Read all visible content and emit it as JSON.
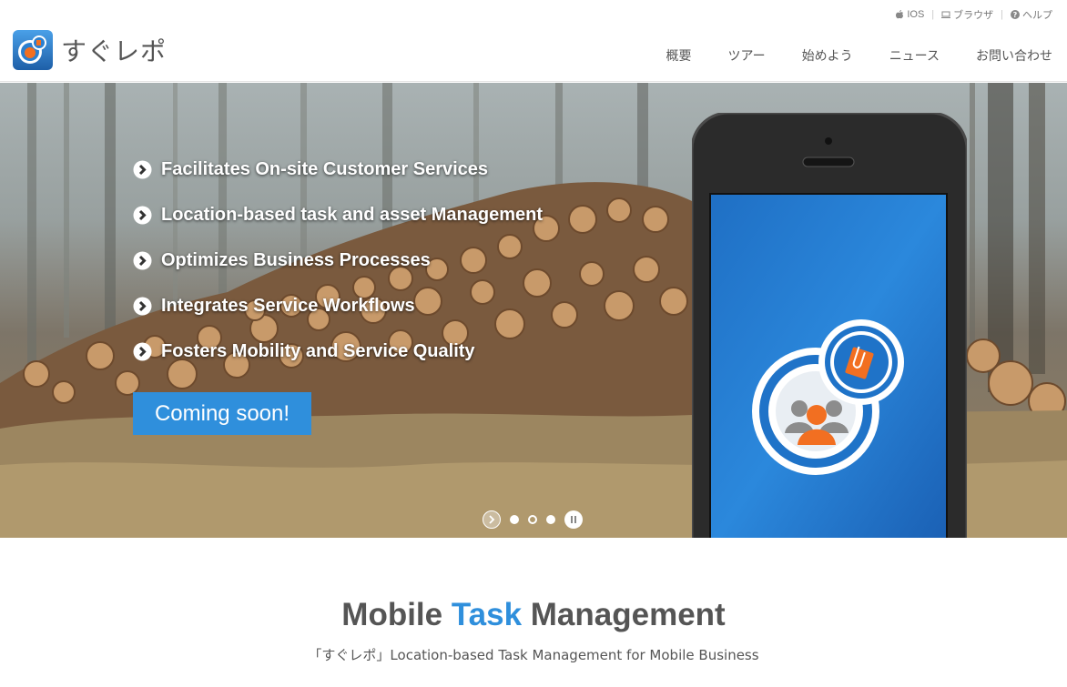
{
  "brand": {
    "name": "すぐレポ"
  },
  "utility": [
    {
      "icon": "apple-icon",
      "label": "IOS"
    },
    {
      "icon": "monitor-icon",
      "label": "ブラウザ"
    },
    {
      "icon": "question-icon",
      "label": "ヘルプ"
    }
  ],
  "nav": [
    "概要",
    "ツアー",
    "始めよう",
    "ニュース",
    "お問い合わせ"
  ],
  "hero": {
    "features": [
      "Facilitates On-site Customer Services",
      "Location-based task and asset Management",
      "Optimizes Business Processes",
      "Integrates Service Workflows",
      "Fosters Mobility and Service Quality"
    ],
    "cta": "Coming soon!",
    "slider": {
      "slides": 3,
      "active": 2
    }
  },
  "section": {
    "title_pre": "Mobile ",
    "title_accent": "Task",
    "title_post": " Management",
    "subtitle": "「すぐレポ」Location-based Task Management for Mobile Business"
  },
  "colors": {
    "accent": "#2f8fdc",
    "cta": "#2f8fdc",
    "header_border": "#e4e4e4"
  }
}
